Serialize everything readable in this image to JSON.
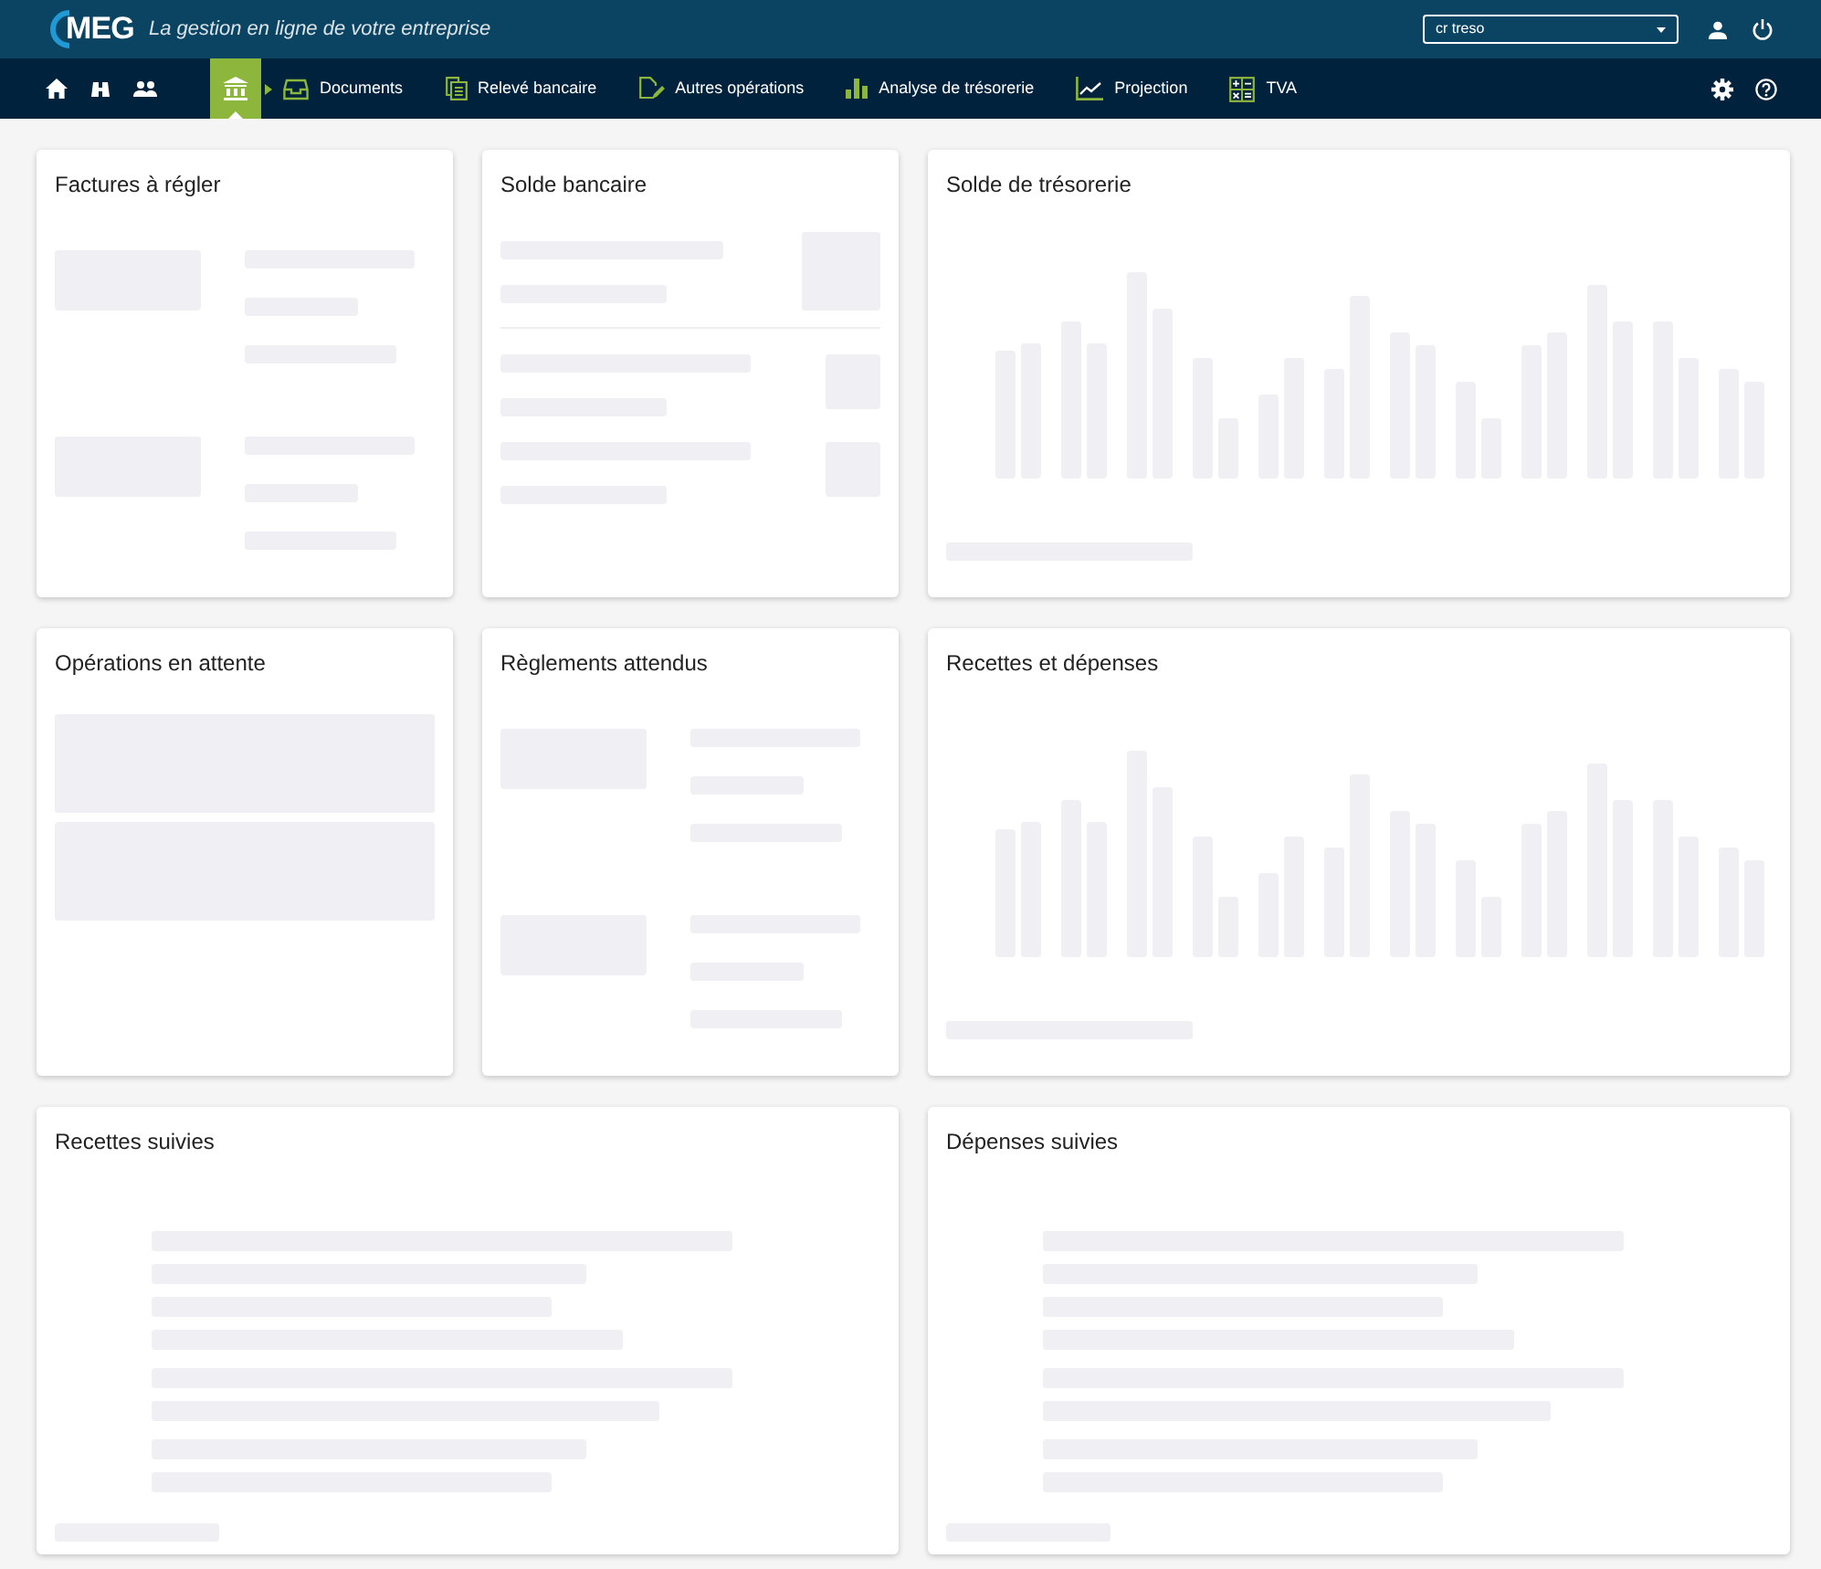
{
  "header": {
    "logo": "MEG",
    "tagline": "La gestion en ligne de votre entreprise",
    "company_select": {
      "value": "cr treso"
    }
  },
  "nav": {
    "items": [
      {
        "selected": true
      },
      {
        "label": "Documents",
        "selected": false
      },
      {
        "label": "Relevé bancaire",
        "selected": false
      },
      {
        "label": "Autres opérations",
        "selected": false
      },
      {
        "label": "Analyse de trésorerie",
        "selected": false
      },
      {
        "label": "Projection",
        "selected": false
      },
      {
        "label": "TVA",
        "selected": false
      }
    ]
  },
  "cards": [
    {
      "title": "Factures à régler",
      "kind": "pairs"
    },
    {
      "title": "Solde bancaire",
      "kind": "balance"
    },
    {
      "title": "Solde de trésorerie",
      "kind": "bars"
    },
    {
      "title": "Opérations en attente",
      "kind": "blocks"
    },
    {
      "title": "Règlements attendus",
      "kind": "pairs"
    },
    {
      "title": "Recettes et dépenses",
      "kind": "bars"
    },
    {
      "title": "Recettes suivies",
      "kind": "lines"
    },
    {
      "title": "Dépenses suivies",
      "kind": "lines"
    }
  ]
}
